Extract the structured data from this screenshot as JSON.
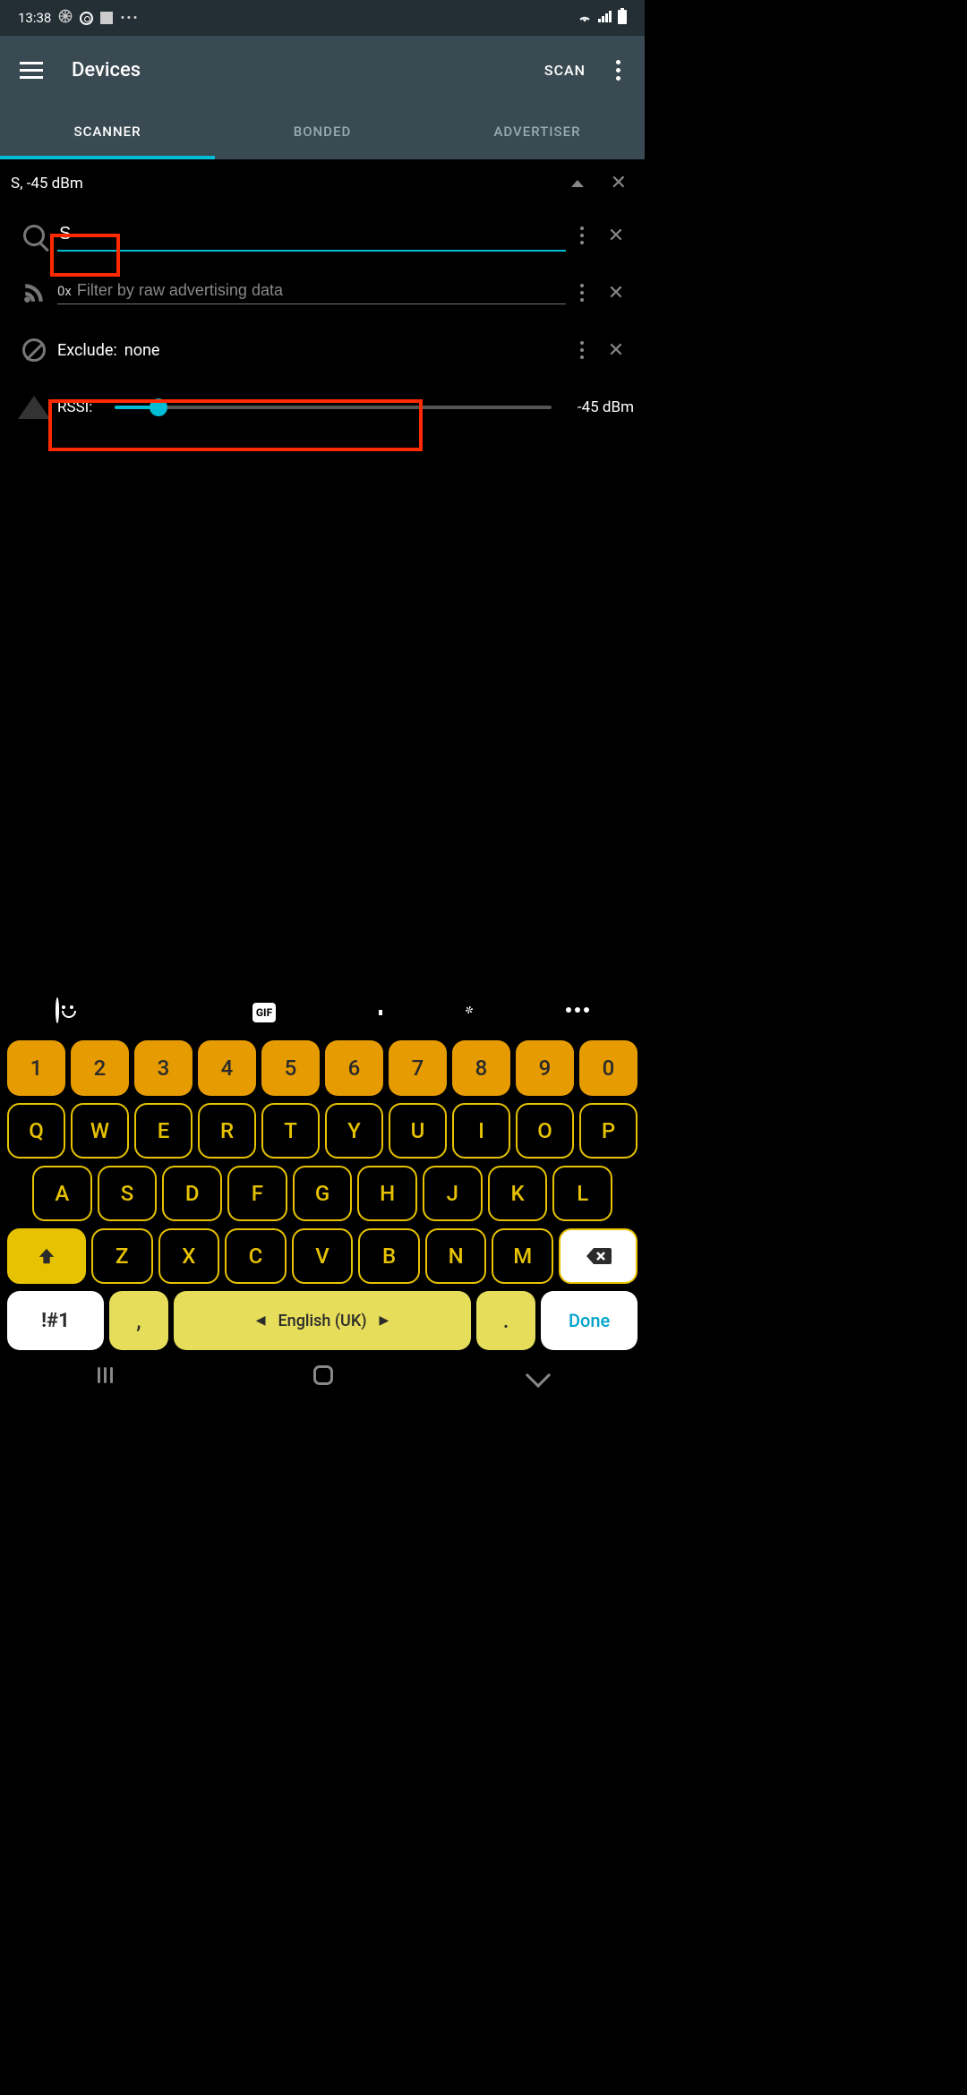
{
  "status": {
    "time": "13:38"
  },
  "appbar": {
    "title": "Devices",
    "scan": "SCAN"
  },
  "tabs": {
    "scanner": "SCANNER",
    "bonded": "BONDED",
    "advertiser": "ADVERTISER"
  },
  "summary": "S, -45 dBm",
  "filters": {
    "name_value": "S",
    "hex_prefix": "0x",
    "hex_placeholder": "Filter by raw advertising data",
    "exclude_label": "Exclude:",
    "exclude_value": "none",
    "rssi_label": "RSSI:",
    "rssi_value": "-45 dBm"
  },
  "keyboard": {
    "row_num": [
      "1",
      "2",
      "3",
      "4",
      "5",
      "6",
      "7",
      "8",
      "9",
      "0"
    ],
    "row_q": [
      "Q",
      "W",
      "E",
      "R",
      "T",
      "Y",
      "U",
      "I",
      "O",
      "P"
    ],
    "row_a": [
      "A",
      "S",
      "D",
      "F",
      "G",
      "H",
      "J",
      "K",
      "L"
    ],
    "row_z": [
      "Z",
      "X",
      "C",
      "V",
      "B",
      "N",
      "M"
    ],
    "sym": "!#1",
    "comma": ",",
    "space": "English (UK)",
    "period": ".",
    "done": "Done"
  }
}
